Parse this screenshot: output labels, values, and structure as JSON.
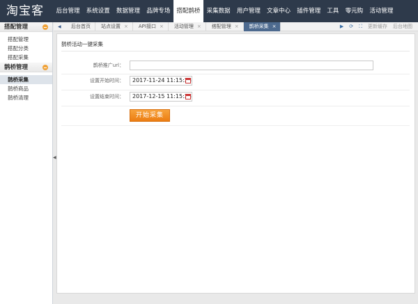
{
  "header": {
    "logo": "淘宝客",
    "nav": [
      "后台管理",
      "系统设置",
      "数据管理",
      "品牌专场",
      "搭配鹊桥",
      "采集数据",
      "用户管理",
      "文章中心",
      "插件管理",
      "工具",
      "零元购",
      "活动管理"
    ],
    "active_nav": "搭配鹊桥"
  },
  "sidebar": {
    "group1": {
      "title": "搭配管理",
      "items": [
        "搭配管理",
        "搭配分类",
        "搭配采集"
      ]
    },
    "group2": {
      "title": "鹊桥管理",
      "items": [
        "鹊桥采集",
        "鹊桥商品",
        "鹊桥清理"
      ]
    },
    "active_item": "鹊桥采集"
  },
  "tabbar": {
    "tabs": [
      "后台首页",
      "站点设置",
      "API接口",
      "活动管理",
      "搭配管理",
      "鹊桥采集"
    ],
    "active_tab": "鹊桥采集",
    "close_glyph": "×",
    "tools": {
      "clear_cache": "更新缓存",
      "site_map": "后台地图"
    }
  },
  "content": {
    "panel_title": "鹊桥活动一键采集",
    "url_label": "鹊桥推广url：",
    "url_value": "",
    "start_label": "设置开始时间：",
    "start_value": "2017-11-24 11:15:23",
    "end_label": "设置结束时间：",
    "end_value": "2017-12-15 11:15:23",
    "submit_label": "开始采集"
  },
  "icons": {
    "tab_prev": "chevron-left-icon",
    "tab_next": "chevron-right-icon",
    "refresh": "refresh-icon",
    "fullscreen": "fullscreen-icon",
    "calendar": "calendar-icon",
    "collapse": "collapse-icon"
  },
  "colors": {
    "header_bg": "#2e3a4b",
    "active_tab_bg": "#4d6a8f",
    "button_orange": "#f08a1f"
  }
}
